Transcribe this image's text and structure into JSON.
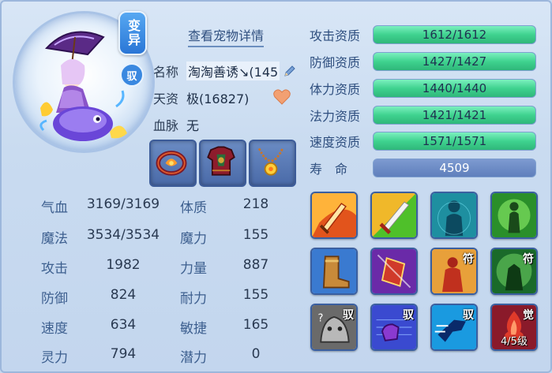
{
  "header": {
    "detail_link": "查看宠物详情"
  },
  "badges": {
    "variant": "变异",
    "tame": "驭"
  },
  "info": {
    "name_label": "名称",
    "name_value": "淘淘善诱↘(145",
    "talent_label": "天资",
    "talent_value": "极(16827)",
    "bloodline_label": "血脉",
    "bloodline_value": "无"
  },
  "equipment": [
    {
      "icon": "ring-icon"
    },
    {
      "icon": "armor-icon"
    },
    {
      "icon": "necklace-icon"
    }
  ],
  "stats": {
    "rows": [
      {
        "l1": "气血",
        "v1": "3169/3169",
        "l2": "体质",
        "v2": "218"
      },
      {
        "l1": "魔法",
        "v1": "3534/3534",
        "l2": "魔力",
        "v2": "155"
      },
      {
        "l1": "攻击",
        "v1": "1982",
        "l2": "力量",
        "v2": "887"
      },
      {
        "l1": "防御",
        "v1": "824",
        "l2": "耐力",
        "v2": "155"
      },
      {
        "l1": "速度",
        "v1": "634",
        "l2": "敏捷",
        "v2": "165"
      },
      {
        "l1": "灵力",
        "v1": "794",
        "l2": "潜力",
        "v2": "0"
      }
    ]
  },
  "aptitudes": [
    {
      "label": "攻击资质",
      "text": "1612/1612",
      "fill": 1.0
    },
    {
      "label": "防御资质",
      "text": "1427/1427",
      "fill": 1.0
    },
    {
      "label": "体力资质",
      "text": "1440/1440",
      "fill": 1.0
    },
    {
      "label": "法力资质",
      "text": "1421/1421",
      "fill": 1.0
    },
    {
      "label": "速度资质",
      "text": "1571/1571",
      "fill": 1.0
    }
  ],
  "life": {
    "label": "寿　命",
    "value": "4509"
  },
  "skills": [
    {
      "icon": "fire-sword-icon",
      "tag": ""
    },
    {
      "icon": "sword-strike-icon",
      "tag": ""
    },
    {
      "icon": "spirit-body-icon",
      "tag": ""
    },
    {
      "icon": "green-aura-icon",
      "tag": ""
    },
    {
      "icon": "boot-icon",
      "tag": ""
    },
    {
      "icon": "magic-shard-icon",
      "tag": ""
    },
    {
      "icon": "rune-body-red-icon",
      "tag": "符"
    },
    {
      "icon": "rune-warrior-green-icon",
      "tag": "符"
    },
    {
      "icon": "stone-beast-icon",
      "tag": "驭"
    },
    {
      "icon": "purple-fist-icon",
      "tag": "驭"
    },
    {
      "icon": "dash-runner-icon",
      "tag": "驭"
    },
    {
      "icon": "awaken-flame-icon",
      "tag": "觉",
      "level": "4/5级"
    }
  ],
  "colors": {
    "bar_fill": "#3fd28f",
    "label_blue": "#3d5f8f",
    "panel_bg": "#c9dbf0"
  }
}
